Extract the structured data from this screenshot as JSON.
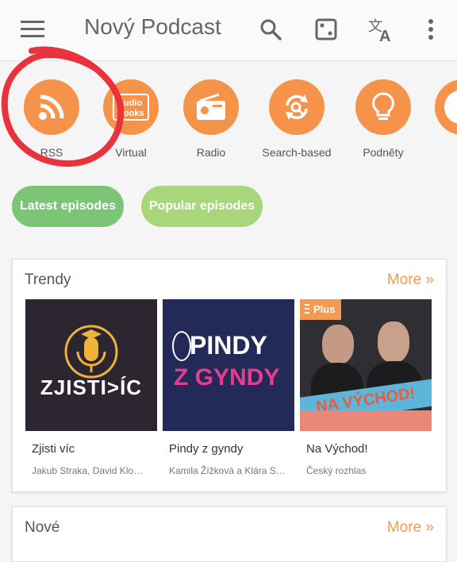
{
  "app_bar": {
    "title": "Nový Podcast",
    "menu_icon": "hamburger-menu-icon",
    "actions": [
      "search-icon",
      "random-dice-icon",
      "translate-icon",
      "more-vert-icon"
    ]
  },
  "categories": [
    {
      "label": "RSS",
      "icon": "rss-icon"
    },
    {
      "label": "Virtual",
      "icon": "audiobooks-icon"
    },
    {
      "label": "Radio",
      "icon": "radio-icon"
    },
    {
      "label": "Search-based",
      "icon": "search-refresh-icon"
    },
    {
      "label": "Podněty",
      "icon": "lightbulb-icon"
    }
  ],
  "chips": {
    "latest": "Latest episodes",
    "popular": "Popular episodes"
  },
  "trending": {
    "title": "Trendy",
    "more": "More »",
    "podcasts": [
      {
        "name": "Zjisti víc",
        "author": "Jakub Straka, David Klo…",
        "art_text": "ZJISTI>ÍC"
      },
      {
        "name": "Pindy z gyndy",
        "author": "Kamila Žížková a Klára S…",
        "art_line1": "PINDY",
        "art_line2": "Z GYNDY"
      },
      {
        "name": "Na Východ!",
        "author": "Český rozhlas",
        "art_badge": "Plus",
        "art_banner": "NA VÝCHOD!"
      }
    ]
  },
  "new_section": {
    "title": "Nové",
    "more": "More »"
  },
  "colors": {
    "accent": "#f5934b",
    "chip_latest": "#7cc576",
    "chip_popular": "#a8d67a",
    "annotation": "#e8323c"
  }
}
